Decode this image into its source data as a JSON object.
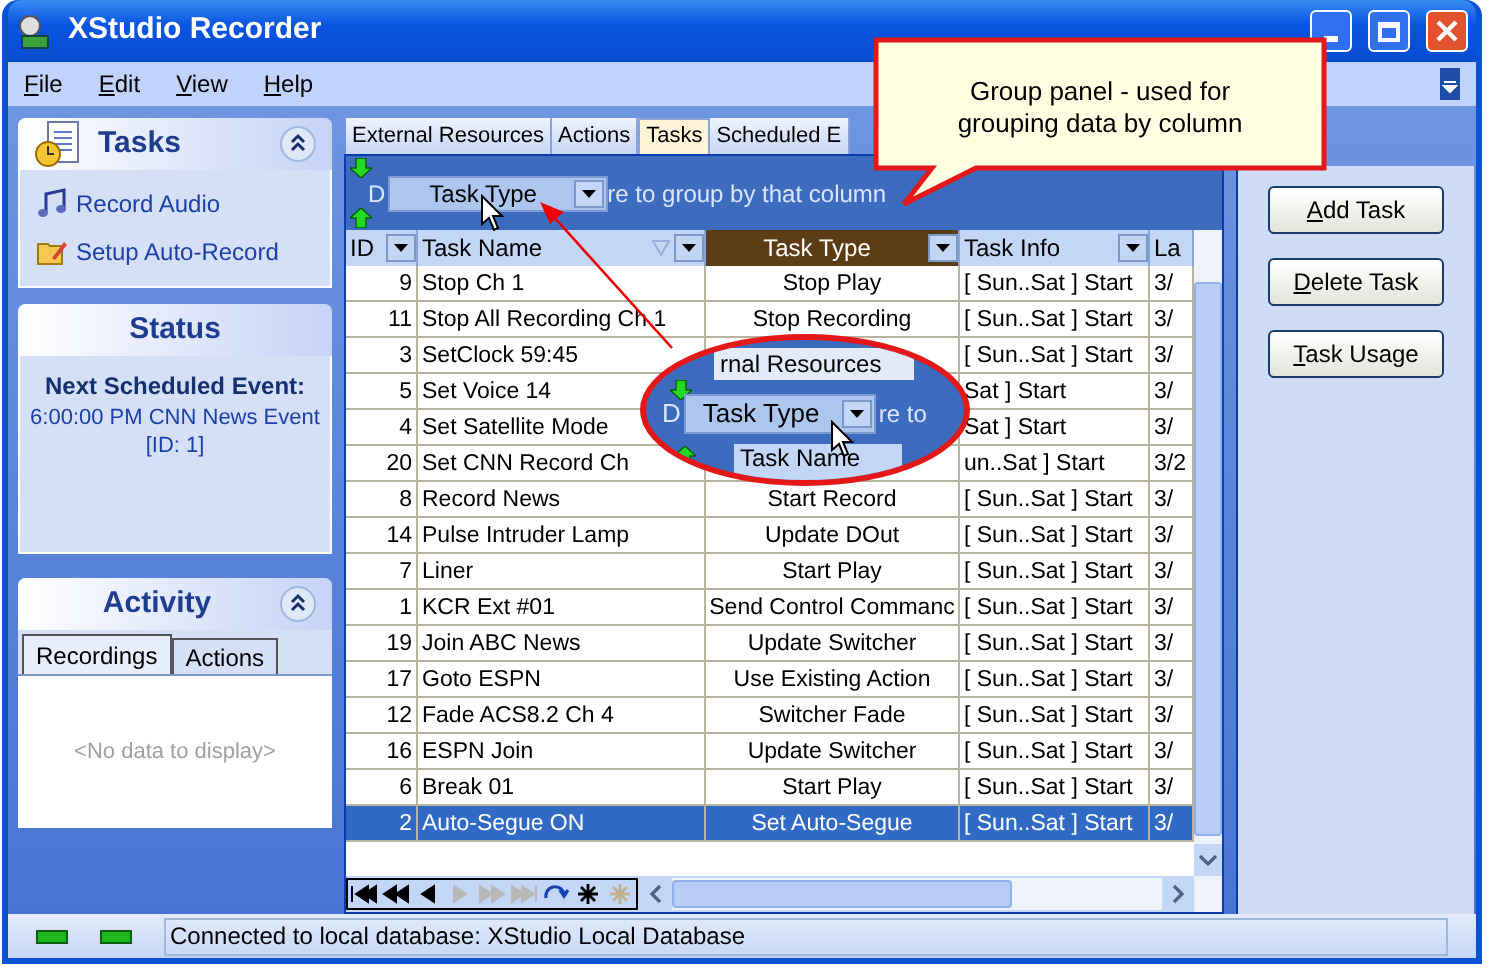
{
  "window": {
    "title": "XStudio Recorder"
  },
  "menu": [
    {
      "label": "File"
    },
    {
      "label": "Edit"
    },
    {
      "label": "View"
    },
    {
      "label": "Help"
    }
  ],
  "tasks_panel": {
    "title": "Tasks",
    "items": [
      {
        "label": "Record Audio",
        "kind": "audio"
      },
      {
        "label": "Setup Auto-Record",
        "kind": "setup"
      }
    ]
  },
  "status_panel": {
    "title": "Status",
    "heading": "Next Scheduled Event:",
    "detail": "6:00:00 PM CNN News Event [ID: 1]"
  },
  "activity_panel": {
    "title": "Activity",
    "tabs": [
      {
        "label": "Recordings",
        "selected": true
      },
      {
        "label": "Actions",
        "selected": false
      }
    ],
    "empty_text": "<No data to display>"
  },
  "tabs": [
    {
      "label": "External Resources",
      "selected": false
    },
    {
      "label": "Actions",
      "selected": false
    },
    {
      "label": "Tasks",
      "selected": true
    },
    {
      "label": "Scheduled E",
      "selected": false
    }
  ],
  "group_panel": {
    "lead": "D",
    "chip": "Task Type",
    "trail": "re to group by that column"
  },
  "table": {
    "columns": [
      {
        "label": "ID",
        "highlighted": false
      },
      {
        "label": "Task Name",
        "highlighted": false
      },
      {
        "label": "Task Type",
        "highlighted": true
      },
      {
        "label": "Task Info",
        "highlighted": false
      },
      {
        "label": "La",
        "highlighted": false
      }
    ],
    "rows": [
      {
        "id": "9",
        "task_name": "Stop Ch 1",
        "task_type": "Stop Play",
        "task_info": "[ Sun..Sat ] Start",
        "column_5": "3/",
        "selected": false
      },
      {
        "id": "11",
        "task_name": "Stop All Recording Ch 1",
        "task_type": "Stop Recording",
        "task_info": "[ Sun..Sat ] Start",
        "column_5": "3/",
        "selected": false
      },
      {
        "id": "3",
        "task_name": "SetClock 59:45",
        "task_info": "[ Sun..Sat ] Start",
        "column_5": "3/",
        "selected": false
      },
      {
        "id": "5",
        "task_name": "Set Voice 14",
        "task_info": "Sat ] Start",
        "column_5": "3/",
        "selected": false
      },
      {
        "id": "4",
        "task_name": "Set Satellite Mode",
        "task_info": "Sat ] Start",
        "column_5": "3/",
        "selected": false
      },
      {
        "id": "20",
        "task_name": "Set CNN Record Ch",
        "task_info": "un..Sat ] Start",
        "column_5": "3/2",
        "selected": false
      },
      {
        "id": "8",
        "task_name": "Record News",
        "task_type": "Start Record",
        "task_info": "[ Sun..Sat ] Start",
        "column_5": "3/",
        "selected": false
      },
      {
        "id": "14",
        "task_name": "Pulse Intruder Lamp",
        "task_type": "Update DOut",
        "task_info": "[ Sun..Sat ] Start",
        "column_5": "3/",
        "selected": false
      },
      {
        "id": "7",
        "task_name": "Liner",
        "task_type": "Start Play",
        "task_info": "[ Sun..Sat ] Start",
        "column_5": "3/",
        "selected": false
      },
      {
        "id": "1",
        "task_name": "KCR Ext #01",
        "task_type": "Send Control Commanc",
        "task_info": "[ Sun..Sat ] Start",
        "column_5": "3/",
        "selected": false
      },
      {
        "id": "19",
        "task_name": "Join ABC News",
        "task_type": "Update Switcher",
        "task_info": "[ Sun..Sat ] Start",
        "column_5": "3/",
        "selected": false
      },
      {
        "id": "17",
        "task_name": "Goto ESPN",
        "task_type": "Use Existing Action",
        "task_info": "[ Sun..Sat ] Start",
        "column_5": "3/",
        "selected": false
      },
      {
        "id": "12",
        "task_name": "Fade ACS8.2 Ch 4",
        "task_type": "Switcher Fade",
        "task_info": "[ Sun..Sat ] Start",
        "column_5": "3/",
        "selected": false
      },
      {
        "id": "16",
        "task_name": "ESPN Join",
        "task_type": "Update Switcher",
        "task_info": "[ Sun..Sat ] Start",
        "column_5": "3/",
        "selected": false
      },
      {
        "id": "6",
        "task_name": "Break 01",
        "task_type": "Start Play",
        "task_info": "[ Sun..Sat ] Start",
        "column_5": "3/",
        "selected": false
      },
      {
        "id": "2",
        "task_name": "Auto-Segue ON",
        "task_type": "Set Auto-Segue",
        "task_info": "[ Sun..Sat ] Start",
        "column_5": "3/",
        "selected": true
      }
    ]
  },
  "buttons": [
    {
      "label": "Add Task"
    },
    {
      "label": "Delete Task"
    },
    {
      "label": "Task Usage"
    }
  ],
  "status_bar": {
    "text": "Connected to local database: XStudio Local Database"
  },
  "callout": {
    "text": "Group panel - used for grouping data by column"
  },
  "magnifier": {
    "tab_fragment": "rnal Resources",
    "lead": "D",
    "chip": "Task Type",
    "trail": "re to",
    "column": "Task Name"
  }
}
